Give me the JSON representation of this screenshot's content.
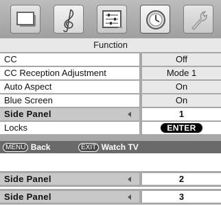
{
  "menu": {
    "tabs": [
      {
        "name": "picture",
        "icon": "tv-screen-icon"
      },
      {
        "name": "audio",
        "icon": "treble-clef-icon"
      },
      {
        "name": "setup",
        "icon": "settings-sliders-icon"
      },
      {
        "name": "function",
        "icon": "clock-icon"
      },
      {
        "name": "locks",
        "icon": "wrench-icon"
      }
    ],
    "title": "Function",
    "rows": [
      {
        "label": "CC",
        "value": "Off"
      },
      {
        "label": "CC Reception Adjustment",
        "value": "Mode 1"
      },
      {
        "label": "Auto Aspect",
        "value": "On"
      },
      {
        "label": "Blue Screen",
        "value": "On"
      },
      {
        "label": "Side Panel",
        "value": "1"
      },
      {
        "label": "Locks",
        "value": "ENTER"
      }
    ],
    "footer": {
      "menu_key": "MENU",
      "back_label": "Back",
      "exit_key": "EXIT",
      "watch_label": "Watch TV"
    }
  },
  "side_panel_steps": [
    {
      "label": "Side Panel",
      "value": "2"
    },
    {
      "label": "Side Panel",
      "value": "3"
    }
  ],
  "colors": {
    "menu_bg": "#a8a8a8",
    "title_bg": "#e8e8e8",
    "footer_bg": "#6a6a6a",
    "highlight_bg": "#c8c8c8"
  }
}
